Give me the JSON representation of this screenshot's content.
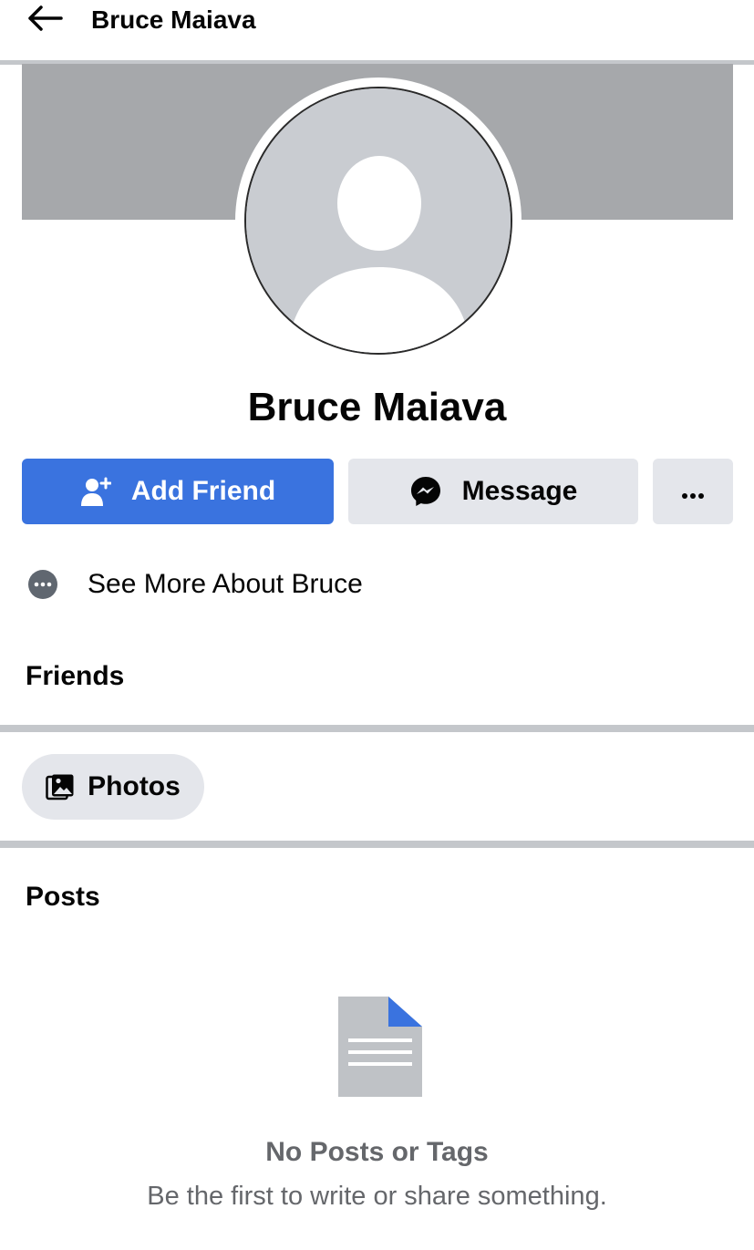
{
  "header": {
    "back_icon": "arrow-left-icon",
    "title": "Bruce Maiava"
  },
  "profile": {
    "name": "Bruce Maiava",
    "avatar_icon": "default-avatar-silhouette"
  },
  "actions": {
    "add_friend_label": "Add Friend",
    "add_friend_icon": "add-friend-icon",
    "message_label": "Message",
    "message_icon": "messenger-icon",
    "more_icon": "more-dots-icon"
  },
  "about": {
    "see_more_label": "See More About Bruce",
    "icon": "more-circle-icon"
  },
  "sections": {
    "friends_label": "Friends",
    "photos_label": "Photos",
    "photos_icon": "photos-icon",
    "posts_label": "Posts"
  },
  "empty_posts": {
    "icon": "document-icon",
    "title": "No Posts or Tags",
    "subtitle": "Be the first to write or share something."
  },
  "colors": {
    "primary_blue": "#3a73df",
    "button_gray": "#e4e6eb",
    "cover_gray": "#a6a8ab",
    "divider_gray": "#c4c7cb",
    "muted_text": "#65676b"
  }
}
